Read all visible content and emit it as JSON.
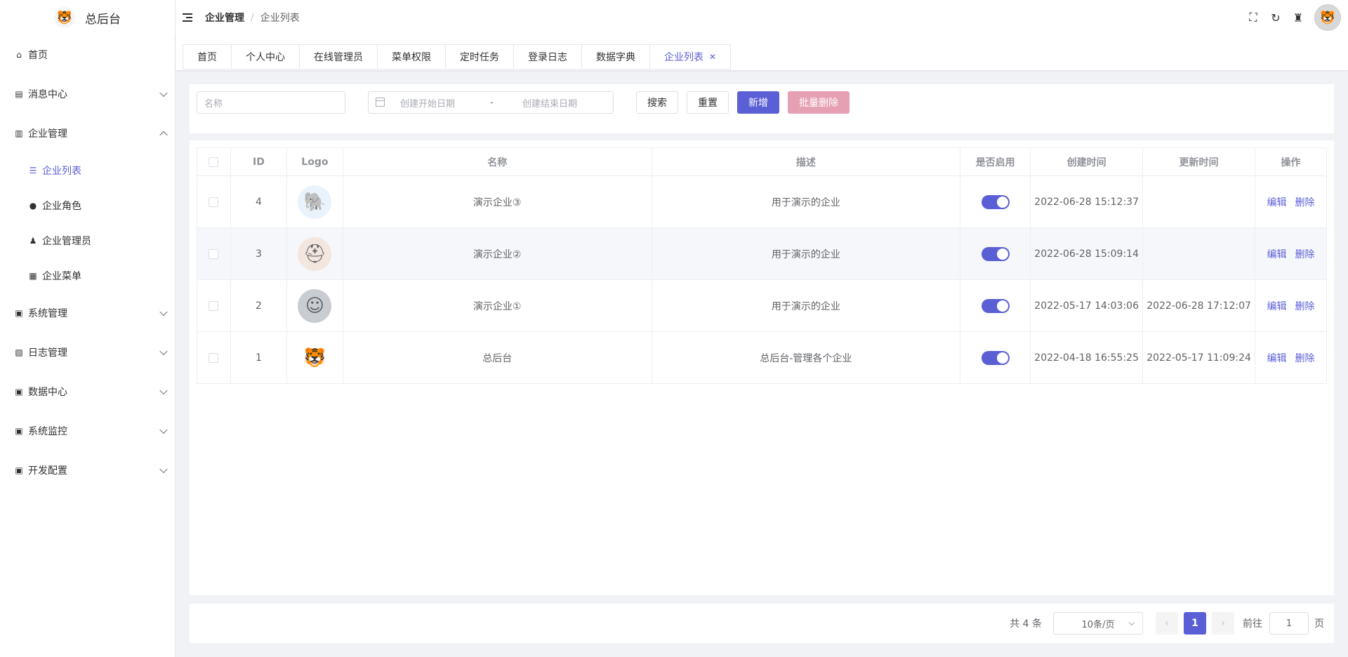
{
  "brand": {
    "title": "总后台",
    "logo_icon": "cartoon-logo"
  },
  "sidebar": {
    "items": [
      {
        "label": "首页",
        "icon": "home-icon"
      },
      {
        "label": "消息中心",
        "icon": "message-icon"
      },
      {
        "label": "企业管理",
        "icon": "building-icon"
      },
      {
        "label": "系统管理",
        "icon": "monitor-icon"
      },
      {
        "label": "日志管理",
        "icon": "log-icon"
      },
      {
        "label": "数据中心",
        "icon": "monitor-icon"
      },
      {
        "label": "系统监控",
        "icon": "monitor-icon"
      },
      {
        "label": "开发配置",
        "icon": "monitor-icon"
      }
    ],
    "sub_items": [
      {
        "label": "企业列表",
        "icon": "list-icon"
      },
      {
        "label": "企业角色",
        "icon": "users-icon"
      },
      {
        "label": "企业管理员",
        "icon": "user-icon"
      },
      {
        "label": "企业菜单",
        "icon": "grid-icon"
      }
    ]
  },
  "header": {
    "breadcrumb": [
      "企业管理",
      "企业列表"
    ],
    "separator": "/"
  },
  "tags": [
    "首页",
    "个人中心",
    "在线管理员",
    "菜单权限",
    "定时任务",
    "登录日志",
    "数据字典",
    "企业列表"
  ],
  "search": {
    "name_placeholder": "名称",
    "start_date_placeholder": "创建开始日期",
    "date_separator": "-",
    "end_date_placeholder": "创建结束日期",
    "search_label": "搜索",
    "reset_label": "重置",
    "add_label": "新增",
    "batch_delete_label": "批量删除"
  },
  "table": {
    "columns": [
      "ID",
      "Logo",
      "名称",
      "描述",
      "是否启用",
      "创建时间",
      "更新时间",
      "操作"
    ],
    "edit_label": "编辑",
    "delete_label": "删除",
    "rows": [
      {
        "id": "4",
        "name": "演示企业③",
        "desc": "用于演示的企业",
        "enabled": true,
        "created": "2022-06-28 15:12:37",
        "updated": ""
      },
      {
        "id": "3",
        "name": "演示企业②",
        "desc": "用于演示的企业",
        "enabled": true,
        "created": "2022-06-28 15:09:14",
        "updated": ""
      },
      {
        "id": "2",
        "name": "演示企业①",
        "desc": "用于演示的企业",
        "enabled": true,
        "created": "2022-05-17 14:03:06",
        "updated": "2022-06-28 17:12:07"
      },
      {
        "id": "1",
        "name": "总后台",
        "desc": "总后台-管理各个企业",
        "enabled": true,
        "created": "2022-04-18 16:55:25",
        "updated": "2022-05-17 11:09:24"
      }
    ]
  },
  "pagination": {
    "total": "共 4 条",
    "page_size": "10条/页",
    "current_page": "1",
    "goto_label": "前往",
    "goto_value": "1",
    "page_suffix": "页"
  },
  "colors": {
    "accent": "#5b5fd6",
    "danger_light": "#e6a0b4"
  }
}
